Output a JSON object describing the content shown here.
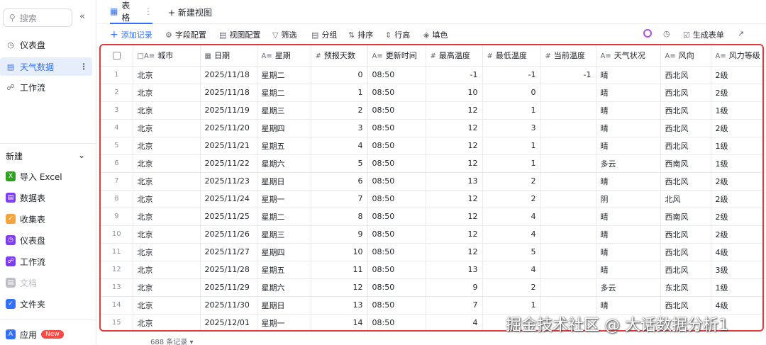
{
  "sidebar": {
    "search_placeholder": "搜索",
    "collapse_icon": "«",
    "items": [
      {
        "label": "仪表盘",
        "icon": "dashboard-icon"
      },
      {
        "label": "天气数据",
        "icon": "table-icon"
      },
      {
        "label": "工作流",
        "icon": "workflow-icon"
      }
    ],
    "new_section": {
      "title": "新建",
      "items": [
        {
          "label": "导入 Excel",
          "color": "#2ea121"
        },
        {
          "label": "数据表",
          "color": "#7f3bf5"
        },
        {
          "label": "收集表",
          "color": "#f5a33a"
        },
        {
          "label": "仪表盘",
          "color": "#7f3bf5"
        },
        {
          "label": "工作流",
          "color": "#7f3bf5"
        },
        {
          "label": "文档",
          "color": "#bbbfc4"
        },
        {
          "label": "文件夹",
          "color": "#3370ff"
        }
      ]
    },
    "app": {
      "label": "应用",
      "badge": "New"
    }
  },
  "tabs": {
    "active": "表格",
    "new_view": "+ 新建视图"
  },
  "toolbar": {
    "add_record": "添加记录",
    "field_config": "字段配置",
    "view_config": "视图配置",
    "filter": "筛选",
    "group": "分组",
    "sort": "排序",
    "row_height": "行高",
    "fill_color": "填色",
    "generate_form": "生成表单"
  },
  "table": {
    "columns": [
      "城市",
      "日期",
      "星期",
      "预报天数",
      "更新时间",
      "最高温度",
      "最低温度",
      "当前温度",
      "天气状况",
      "风向",
      "风力等级"
    ],
    "rows": [
      [
        "1",
        "北京",
        "2025/11/18",
        "星期二",
        "0",
        "08:50",
        "-1",
        "-1",
        "-1",
        "晴",
        "西北风",
        "2级"
      ],
      [
        "2",
        "北京",
        "2025/11/18",
        "星期二",
        "1",
        "08:50",
        "10",
        "0",
        "",
        "晴",
        "西北风",
        "2级"
      ],
      [
        "3",
        "北京",
        "2025/11/19",
        "星期三",
        "2",
        "08:50",
        "12",
        "1",
        "",
        "晴",
        "西北风",
        "1级"
      ],
      [
        "4",
        "北京",
        "2025/11/20",
        "星期四",
        "3",
        "08:50",
        "12",
        "3",
        "",
        "晴",
        "西北风",
        "2级"
      ],
      [
        "5",
        "北京",
        "2025/11/21",
        "星期五",
        "4",
        "08:50",
        "12",
        "1",
        "",
        "晴",
        "西北风",
        "1级"
      ],
      [
        "6",
        "北京",
        "2025/11/22",
        "星期六",
        "5",
        "08:50",
        "12",
        "1",
        "",
        "多云",
        "西南风",
        "1级"
      ],
      [
        "7",
        "北京",
        "2025/11/23",
        "星期日",
        "6",
        "08:50",
        "13",
        "2",
        "",
        "晴",
        "西北风",
        "2级"
      ],
      [
        "8",
        "北京",
        "2025/11/24",
        "星期一",
        "7",
        "08:50",
        "12",
        "2",
        "",
        "阴",
        "北风",
        "2级"
      ],
      [
        "9",
        "北京",
        "2025/11/25",
        "星期二",
        "8",
        "08:50",
        "12",
        "4",
        "",
        "晴",
        "西南风",
        "2级"
      ],
      [
        "10",
        "北京",
        "2025/11/26",
        "星期三",
        "9",
        "08:50",
        "12",
        "4",
        "",
        "晴",
        "西北风",
        "2级"
      ],
      [
        "11",
        "北京",
        "2025/11/27",
        "星期四",
        "10",
        "08:50",
        "12",
        "5",
        "",
        "晴",
        "西北风",
        "4级"
      ],
      [
        "12",
        "北京",
        "2025/11/28",
        "星期五",
        "11",
        "08:50",
        "13",
        "4",
        "",
        "晴",
        "西北风",
        "3级"
      ],
      [
        "13",
        "北京",
        "2025/11/29",
        "星期六",
        "12",
        "08:50",
        "9",
        "2",
        "",
        "多云",
        "东北风",
        "1级"
      ],
      [
        "14",
        "北京",
        "2025/11/30",
        "星期日",
        "13",
        "08:50",
        "7",
        "1",
        "",
        "晴",
        "西北风",
        "4级"
      ],
      [
        "15",
        "北京",
        "2025/12/01",
        "星期一",
        "14",
        "08:50",
        "4",
        "",
        "",
        "",
        "",
        ""
      ]
    ],
    "record_count": "688 条记录"
  },
  "watermark": "掘金技术社区 @ 大话数据分析1",
  "colors": {
    "accent": "#3370ff",
    "highlight_border": "#e5383b"
  }
}
